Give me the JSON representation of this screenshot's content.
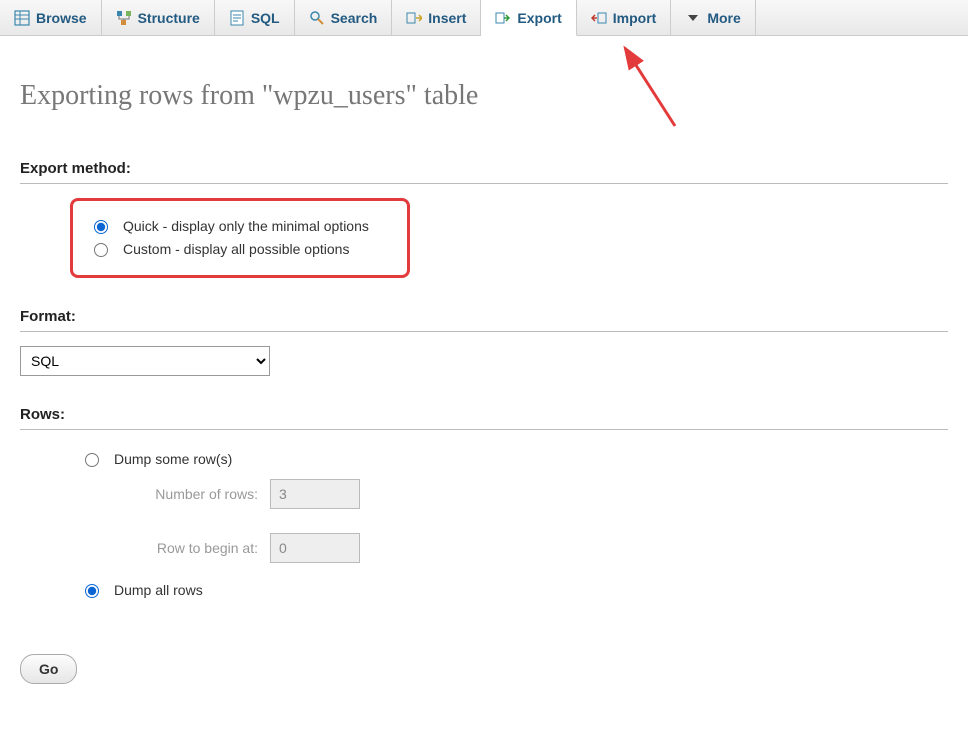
{
  "tabs": {
    "browse": "Browse",
    "structure": "Structure",
    "sql": "SQL",
    "search": "Search",
    "insert": "Insert",
    "export": "Export",
    "import": "Import",
    "more": "More"
  },
  "page_title": "Exporting rows from \"wpzu_users\" table",
  "sections": {
    "export_method": {
      "legend": "Export method:",
      "options": {
        "quick": "Quick - display only the minimal options",
        "custom": "Custom - display all possible options"
      },
      "selected": "quick"
    },
    "format": {
      "legend": "Format:",
      "selected": "SQL",
      "options": [
        "SQL"
      ]
    },
    "rows": {
      "legend": "Rows:",
      "dump_some_label": "Dump some row(s)",
      "dump_all_label": "Dump all rows",
      "selected": "all",
      "num_rows_label": "Number of rows:",
      "num_rows_value": "3",
      "row_begin_label": "Row to begin at:",
      "row_begin_value": "0"
    }
  },
  "go_button": "Go"
}
